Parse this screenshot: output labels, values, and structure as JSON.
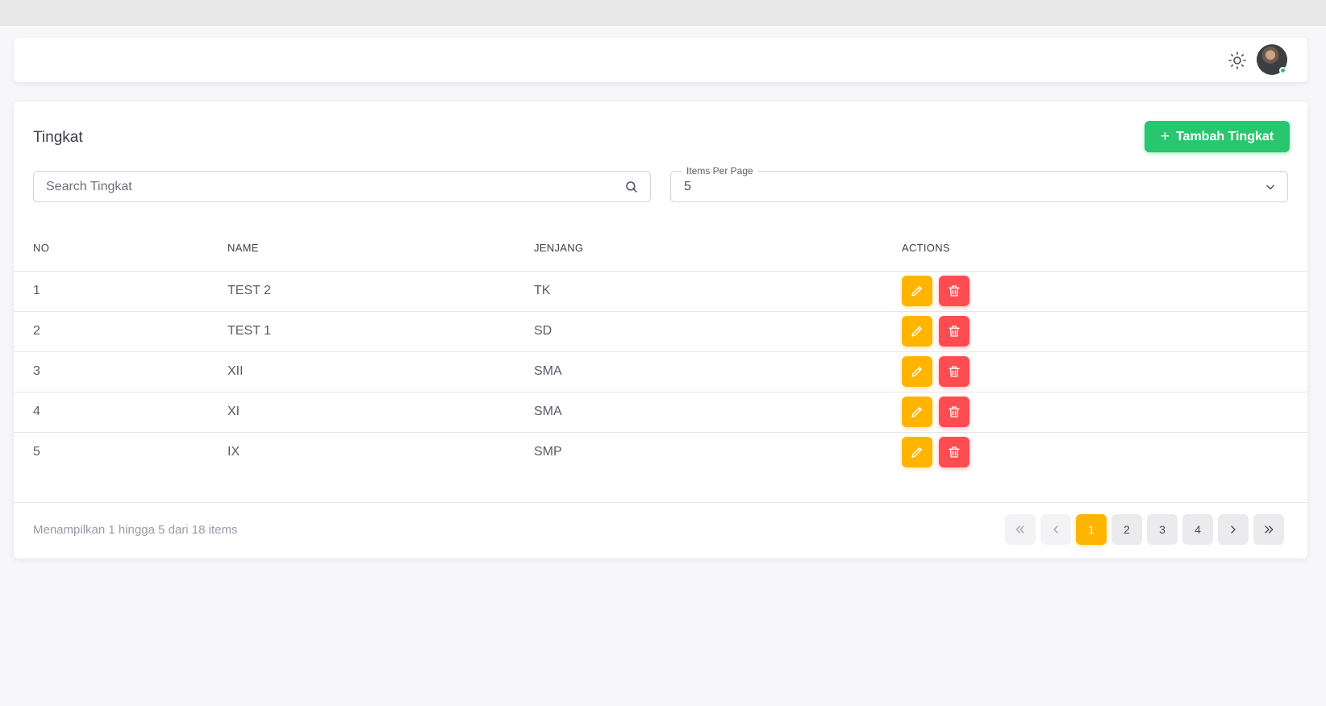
{
  "page": {
    "title": "Tingkat",
    "add_button_label": "Tambah Tingkat"
  },
  "header": {
    "theme_icon": "sun-icon",
    "status_color": "#28c76f"
  },
  "search": {
    "placeholder": "Search Tingkat",
    "value": ""
  },
  "items_per_page": {
    "label": "Items Per Page",
    "value": "5"
  },
  "table": {
    "headers": [
      "NO",
      "NAME",
      "JENJANG",
      "ACTIONS"
    ],
    "rows": [
      {
        "no": "1",
        "name": "TEST 2",
        "jenjang": "TK"
      },
      {
        "no": "2",
        "name": "TEST 1",
        "jenjang": "SD"
      },
      {
        "no": "3",
        "name": "XII",
        "jenjang": "SMA"
      },
      {
        "no": "4",
        "name": "XI",
        "jenjang": "SMA"
      },
      {
        "no": "5",
        "name": "IX",
        "jenjang": "SMP"
      }
    ]
  },
  "footer": {
    "summary": "Menampilkan 1 hingga 5 dari 18 items"
  },
  "pagination": {
    "pages": [
      "1",
      "2",
      "3",
      "4"
    ],
    "current": "1"
  },
  "colors": {
    "primary_success": "#28c76f",
    "edit": "#ffb400",
    "delete": "#ff4c51"
  }
}
